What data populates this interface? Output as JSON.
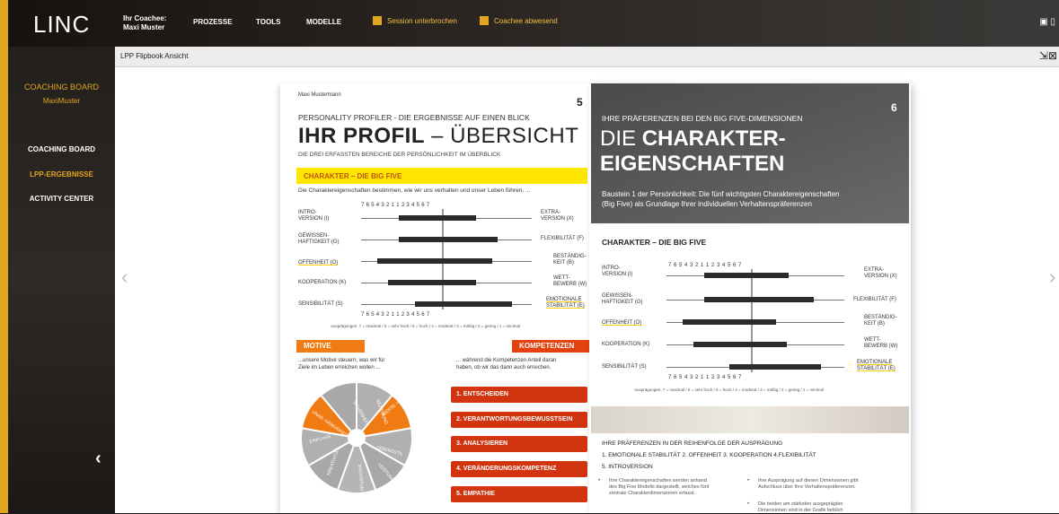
{
  "app": {
    "logo": "LINC",
    "coachee_label": "Ihr Coachee:",
    "coachee_name": "Maxi Muster"
  },
  "topnav": [
    "PROZESSE",
    "TOOLS",
    "MODELLE"
  ],
  "status": {
    "session": "Session unterbrochen",
    "coachee": "Coachee abwesend"
  },
  "sidebar": {
    "board_title": "COACHING BOARD",
    "board_user": "MaxiMuster",
    "items": [
      "COACHING BOARD",
      "LPP-ERGEBNISSE",
      "ACTIVITY CENTER"
    ]
  },
  "viewer": {
    "title": "LPP Flipbook Ansicht"
  },
  "left_page": {
    "name": "Maxi Mustermann",
    "number": "5",
    "kicker": "PERSONALITY PROFILER - DIE ERGEBNISSE AUF EINEN BLICK",
    "title_bold": "IHR PROFIL",
    "title_rest": " – ÜBERSICHT",
    "subtitle": "DIE DREI ERFASSTEN BEREICHE DER PERSÖNLICHKEIT IM ÜBERBLICK",
    "section": "CHARAKTER – DIE BIG FIVE",
    "intro": "Die Charaktereigenschaften bestimmen, wie wir uns verhalten und unser Leben führen, ...",
    "scale": "7   6   5   4   3   2   1          1   2   3   4   5   6   7",
    "legend": "Ausprägungen: 7 = maximal / 6 = sehr hoch / 5 = hoch / 4 = moderat / 3 = mäßig / 2 = gering / 1 = minimal",
    "rows": [
      {
        "left": "INTRO-\nVERSION (I)",
        "right": "EXTRA-\nVERSION (X)"
      },
      {
        "left": "GEWISSEN-\nHAFTIGKEIT (G)",
        "right": "FLEXIBILITÄT (F)"
      },
      {
        "left": "OFFENHEIT (O)",
        "right": "BESTÄNDIG-\nKEIT (B)"
      },
      {
        "left": "KOOPERATION (K)",
        "right": "WETT-\nBEWERB (W)"
      },
      {
        "left": "SENSIBILITÄT (S)",
        "right": "EMOTIONALE\nSTABILITÄT (E)"
      }
    ],
    "motive": "MOTIVE",
    "motive_text": "...unsere Motive steuern, was wir für\nZiele im Leben erreichen wollen ...",
    "kompetenzen": "KOMPETENZEN",
    "komp_text": "... während die Kompetenzen Anteil daran\nhaben, ob wir das dann auch erreichen.",
    "komp_items": [
      "1. ENTSCHEIDEN",
      "2. VERANTWORTUNGSBEWUSSTSEIN",
      "3. ANALYSIEREN",
      "4. VERÄNDERUNGSKOMPETENZ",
      "5. EMPATHIE"
    ],
    "pie_labels": [
      "SICHERHEIT",
      "BEZIEHUNG",
      "WERTE + SINN",
      "LEBENSSTIL",
      "LEISTUNG",
      "WACHSTUM",
      "KREATIVITÄT",
      "EINFLUSS",
      "UNAB-\nHÄNGIGKEIT"
    ]
  },
  "right_page": {
    "number": "6",
    "kicker": "IHRE PRÄFERENZEN BEI DEN BIG FIVE-DIMENSIONEN",
    "title_a": "DIE ",
    "title_b": "CHARAKTER-",
    "title_c": "EIGENSCHAFTEN",
    "desc": "Baustein 1 der Persönlichkeit: Die fünf wichtigsten Charaktereigenschaften\n(Big Five) als Grundlage Ihrer individuellen Verhaltenspräferenzen",
    "section": "CHARAKTER – DIE BIG FIVE",
    "scale": "7   6   5   4   3   2   1          1   2   3   4   5   6   7",
    "legend": "Ausprägungen: 7 = maximal / 6 = sehr hoch / 5 = hoch / 4 = moderat / 3 = mäßig / 2 = gering / 1 = minimal",
    "order_title": "IHRE PRÄFERENZEN IN DER REIHENFOLGE DER AUSPRÄGUNG",
    "order_line1": "1. EMOTIONALE STABILITÄT   2. OFFENHEIT   3. KOOPERATION   4.FLEXIBILITÄT",
    "order_line2": "5. INTROVERSION",
    "bullet1": "Ihre Charaktereigenschaften werden anhand\ndes Big Five Modells dargestellt, welches fünf\nzentrale Charakterdimensionen erfasst.",
    "bullet2": "Ihre Ausprägung auf diesen Dimensionen gibt\nAufschluss über Ihre Verhaltenspräferenzen.",
    "bullet3": "Die beiden am stärksten ausgeprägten\nDimensionen sind in der Grafik farblich"
  }
}
